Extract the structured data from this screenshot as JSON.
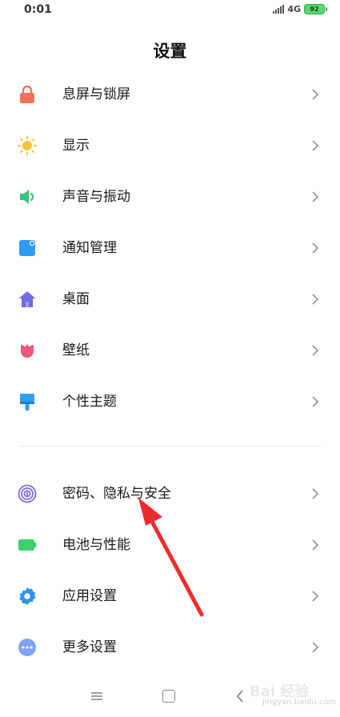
{
  "status": {
    "time": "0:01",
    "network": "4G",
    "battery": "92"
  },
  "header": {
    "title": "设置"
  },
  "menu": [
    {
      "label": "息屏与锁屏",
      "icon": "lock-icon",
      "color": "#f4705a"
    },
    {
      "label": "显示",
      "icon": "sun-icon",
      "color": "#f7c23a"
    },
    {
      "label": "声音与振动",
      "icon": "speaker-icon",
      "color": "#34c47a"
    },
    {
      "label": "通知管理",
      "icon": "notification-icon",
      "color": "#2e9af0"
    },
    {
      "label": "桌面",
      "icon": "home-icon",
      "color": "#6f6ce8"
    },
    {
      "label": "壁纸",
      "icon": "tulip-icon",
      "color": "#f0577e"
    },
    {
      "label": "个性主题",
      "icon": "brush-icon",
      "color": "#2b9ff0"
    },
    {
      "label": "密码、隐私与安全",
      "icon": "fingerprint-icon",
      "color": "#7a6cf0"
    },
    {
      "label": "电池与性能",
      "icon": "battery-icon",
      "color": "#3bd16a"
    },
    {
      "label": "应用设置",
      "icon": "gear-icon",
      "color": "#2e92ea"
    },
    {
      "label": "更多设置",
      "icon": "more-icon",
      "color": "#7fa2f5"
    }
  ],
  "annotation": {
    "arrow_color": "#ef2b2b"
  },
  "watermark": {
    "text": "jingyan.baidu.com"
  }
}
